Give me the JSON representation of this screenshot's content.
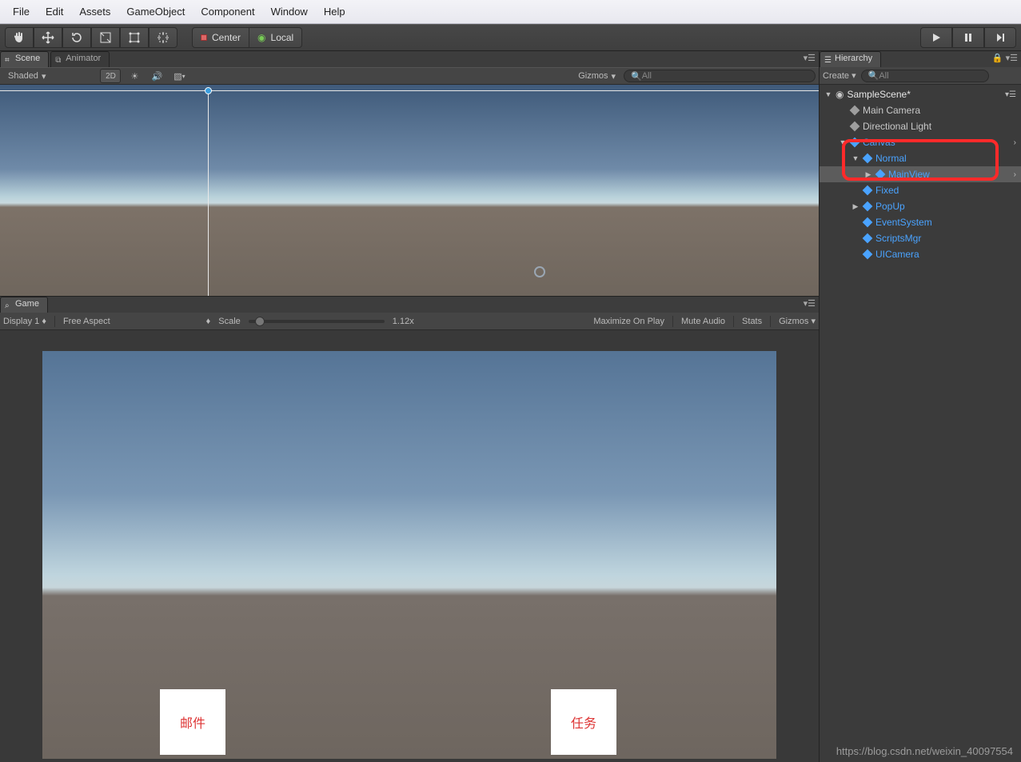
{
  "menu": {
    "items": [
      "File",
      "Edit",
      "Assets",
      "GameObject",
      "Component",
      "Window",
      "Help"
    ]
  },
  "toolbar": {
    "pivot_label": "Center",
    "handle_label": "Local"
  },
  "scene_tabs": {
    "scene": "Scene",
    "animator": "Animator"
  },
  "scene_sub": {
    "shading": "Shaded",
    "mode2d": "2D",
    "gizmos": "Gizmos",
    "search_prefix": "All"
  },
  "game_tab": {
    "label": "Game"
  },
  "game_toolbar": {
    "display": "Display 1",
    "aspect": "Free Aspect",
    "scale_label": "Scale",
    "scale_value": "1.12x",
    "max_on_play": "Maximize On Play",
    "mute": "Mute Audio",
    "stats": "Stats",
    "gizmos": "Gizmos"
  },
  "game_buttons": {
    "mail": "邮件",
    "task": "任务"
  },
  "hierarchy": {
    "tab": "Hierarchy",
    "create": "Create",
    "search_prefix": "All",
    "scene_root": "SampleScene*",
    "items": [
      {
        "label": "Main Camera",
        "depth": 1,
        "blue": false
      },
      {
        "label": "Directional Light",
        "depth": 1,
        "blue": false
      },
      {
        "label": "Canvas",
        "depth": 1,
        "blue": true,
        "expand": true,
        "arrow": true
      },
      {
        "label": "Normal",
        "depth": 2,
        "blue": true,
        "expand": true
      },
      {
        "label": "MainView",
        "depth": 3,
        "blue": true,
        "selected": true,
        "arrow": true,
        "caret": true
      },
      {
        "label": "Fixed",
        "depth": 2,
        "blue": true
      },
      {
        "label": "PopUp",
        "depth": 2,
        "blue": true,
        "caret": true
      },
      {
        "label": "EventSystem",
        "depth": 2,
        "blue": true
      },
      {
        "label": "ScriptsMgr",
        "depth": 2,
        "blue": true
      },
      {
        "label": "UICamera",
        "depth": 2,
        "blue": true
      }
    ]
  },
  "watermark": "https://blog.csdn.net/weixin_40097554"
}
